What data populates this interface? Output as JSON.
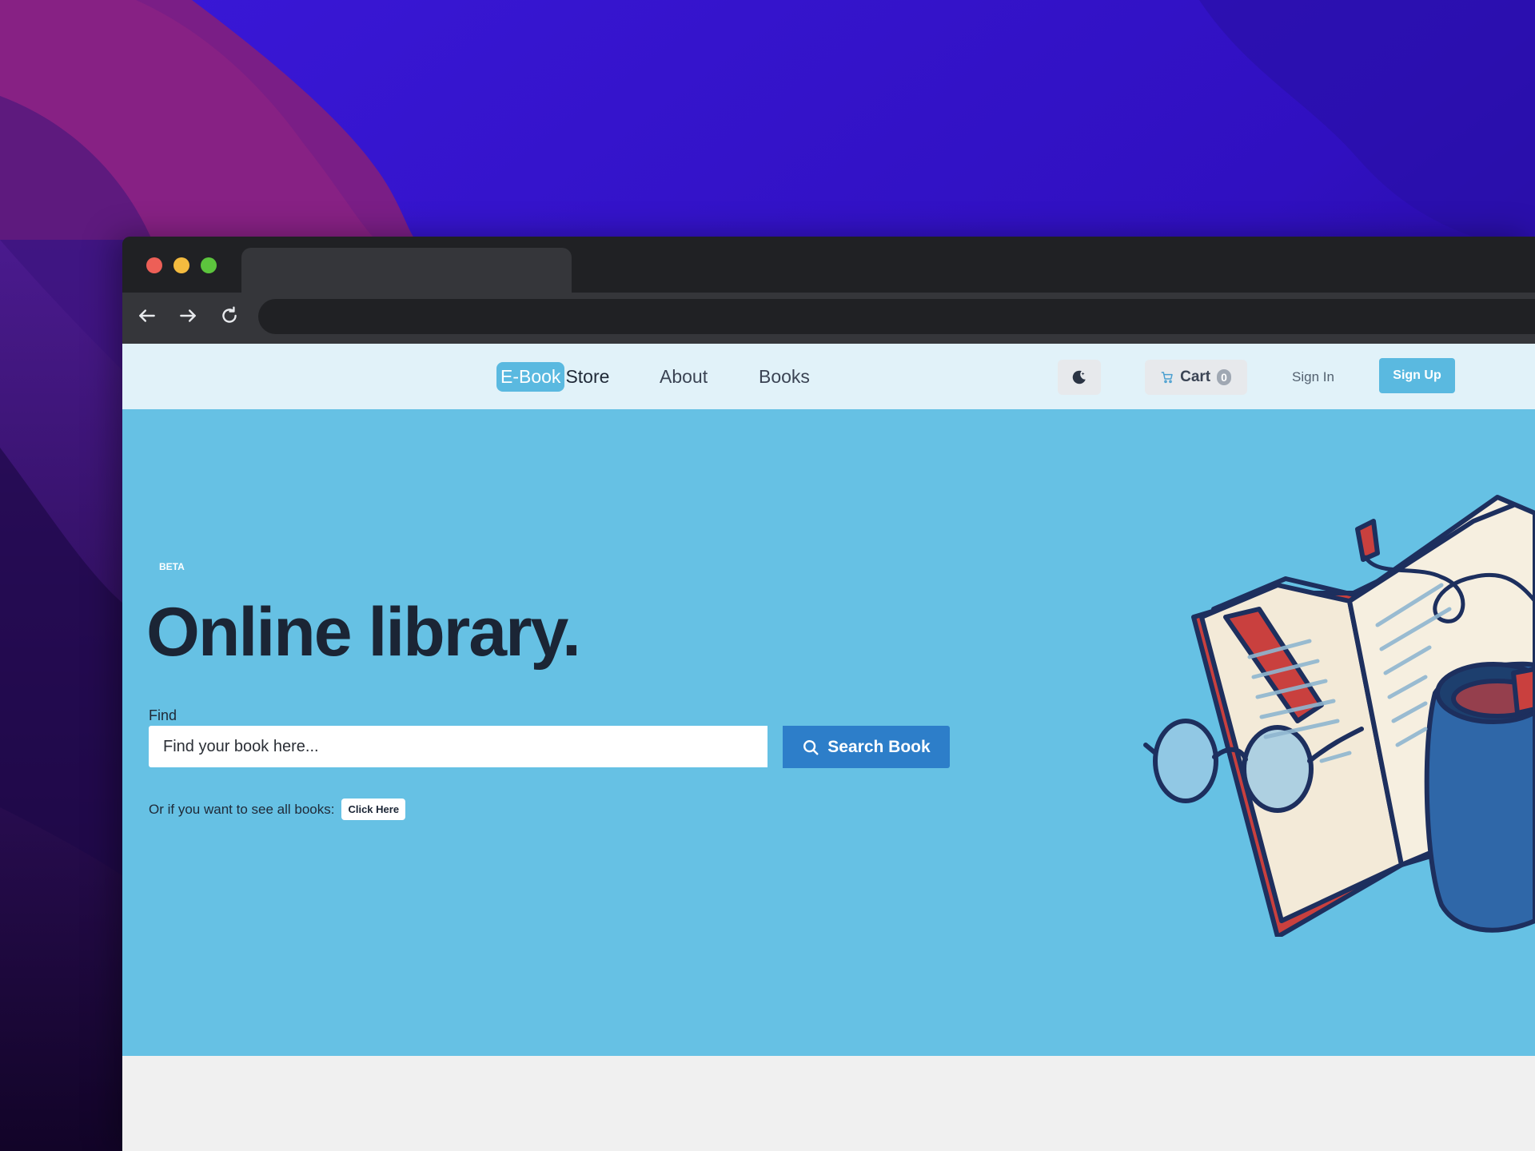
{
  "colors": {
    "navbar_bg": "#e1f2f9",
    "hero_bg": "#66c1e4",
    "accent": "#5ab9e0",
    "search_button": "#2d7ec9",
    "title_text": "#1b2535"
  },
  "icons": [
    "back-arrow-icon",
    "forward-arrow-icon",
    "reload-icon",
    "moon-icon",
    "cart-icon",
    "search-icon"
  ],
  "navbar": {
    "brand_highlight": "E-Book",
    "brand_rest": "Store",
    "links": [
      {
        "label": "About"
      },
      {
        "label": "Books"
      }
    ],
    "cart_label": "Cart",
    "cart_count": "0",
    "sign_in": "Sign In",
    "sign_up": "Sign Up"
  },
  "hero": {
    "badge": "BETA",
    "title": "Online library.",
    "find_label": "Find",
    "search_placeholder": "Find your book here...",
    "search_button": "Search Book",
    "all_books_text": "Or if you want to see all books:",
    "click_here": "Click Here"
  }
}
